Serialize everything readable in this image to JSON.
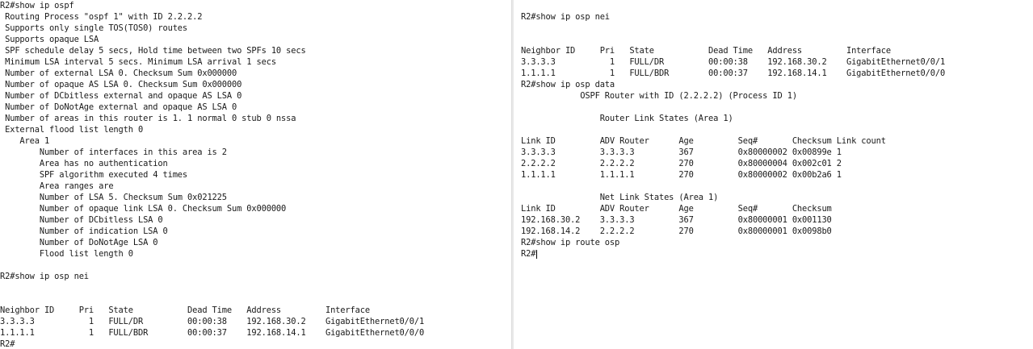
{
  "left_terminal": {
    "lines": [
      "R2#show ip ospf",
      " Routing Process \"ospf 1\" with ID 2.2.2.2",
      " Supports only single TOS(TOS0) routes",
      " Supports opaque LSA",
      " SPF schedule delay 5 secs, Hold time between two SPFs 10 secs",
      " Minimum LSA interval 5 secs. Minimum LSA arrival 1 secs",
      " Number of external LSA 0. Checksum Sum 0x000000",
      " Number of opaque AS LSA 0. Checksum Sum 0x000000",
      " Number of DCbitless external and opaque AS LSA 0",
      " Number of DoNotAge external and opaque AS LSA 0",
      " Number of areas in this router is 1. 1 normal 0 stub 0 nssa",
      " External flood list length 0",
      "    Area 1",
      "        Number of interfaces in this area is 2",
      "        Area has no authentication",
      "        SPF algorithm executed 4 times",
      "        Area ranges are",
      "        Number of LSA 5. Checksum Sum 0x021225",
      "        Number of opaque link LSA 0. Checksum Sum 0x000000",
      "        Number of DCbitless LSA 0",
      "        Number of indication LSA 0",
      "        Number of DoNotAge LSA 0",
      "        Flood list length 0",
      "",
      "R2#show ip osp nei",
      "",
      "",
      "Neighbor ID     Pri   State           Dead Time   Address         Interface",
      "3.3.3.3           1   FULL/DR         00:00:38    192.168.30.2    GigabitEthernet0/0/1",
      "1.1.1.1           1   FULL/BDR        00:00:37    192.168.14.1    GigabitEthernet0/0/0",
      "R2#"
    ]
  },
  "right_terminal": {
    "lines": [
      "R2#show ip osp nei",
      "",
      "",
      "Neighbor ID     Pri   State           Dead Time   Address         Interface",
      "3.3.3.3           1   FULL/DR         00:00:38    192.168.30.2    GigabitEthernet0/0/1",
      "1.1.1.1           1   FULL/BDR        00:00:37    192.168.14.1    GigabitEthernet0/0/0",
      "R2#show ip osp data",
      "            OSPF Router with ID (2.2.2.2) (Process ID 1)",
      "",
      "                Router Link States (Area 1)",
      "",
      "Link ID         ADV Router      Age         Seq#       Checksum Link count",
      "3.3.3.3         3.3.3.3         367         0x80000002 0x00899e 1",
      "2.2.2.2         2.2.2.2         270         0x80000004 0x002c01 2",
      "1.1.1.1         1.1.1.1         270         0x80000002 0x00b2a6 1",
      "",
      "                Net Link States (Area 1)",
      "Link ID         ADV Router      Age         Seq#       Checksum",
      "192.168.30.2    3.3.3.3         367         0x80000001 0x001130",
      "192.168.14.2    2.2.2.2         270         0x80000001 0x0098b0",
      "R2#show ip route osp",
      "R2#"
    ]
  }
}
